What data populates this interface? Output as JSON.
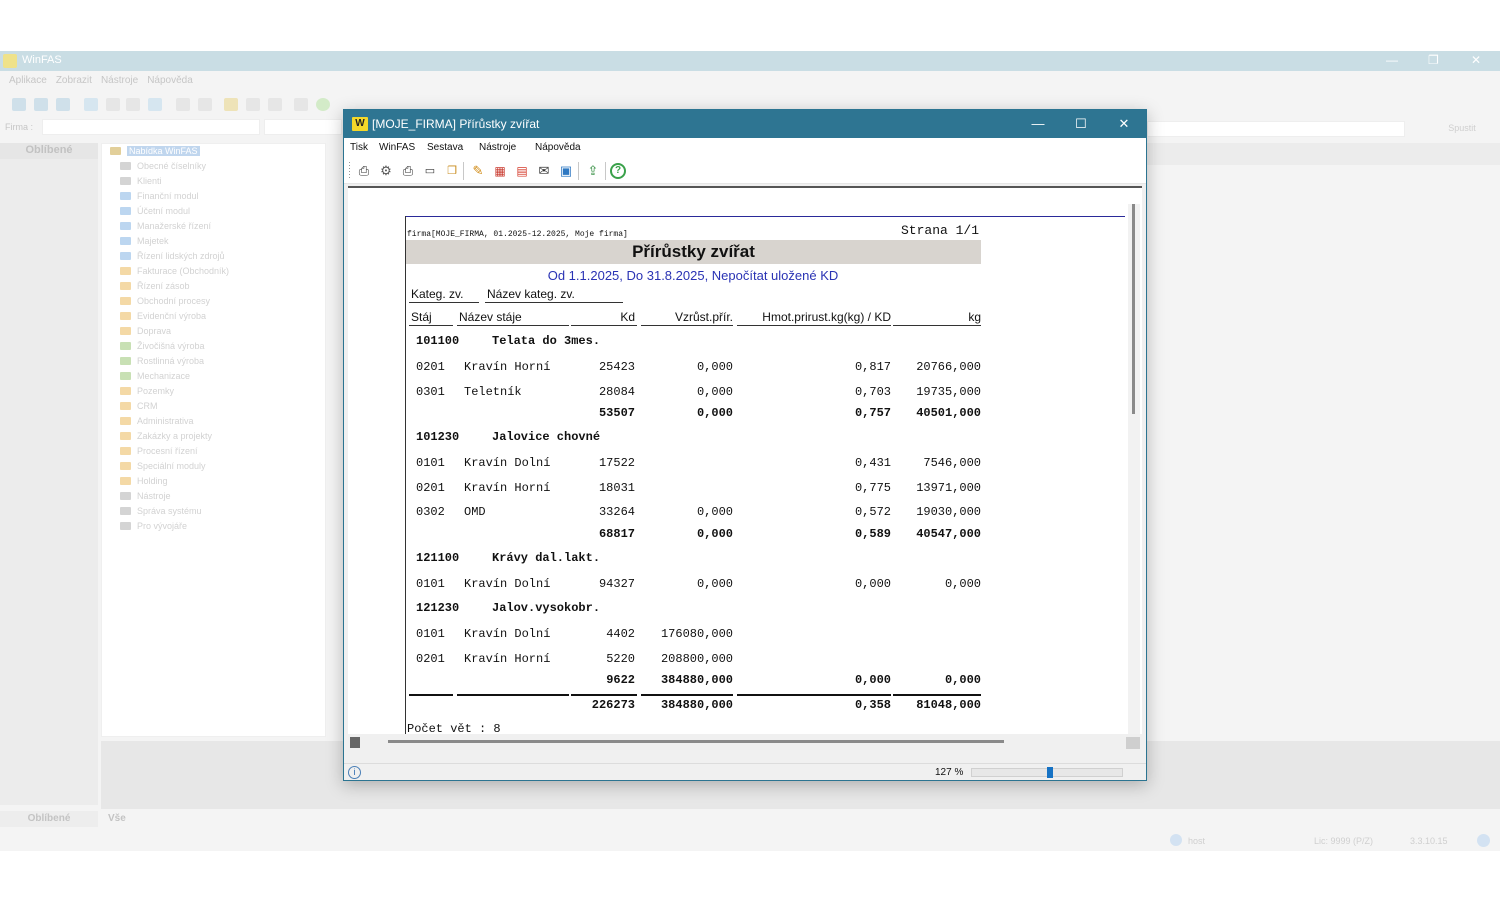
{
  "background_app": {
    "title": "WinFAS",
    "menu": [
      "Aplikace",
      "Zobrazit",
      "Nástroje",
      "Nápověda"
    ],
    "firma_label": "Firma :",
    "left_panel_header": "Oblíbené",
    "tree_root": "Nabídka WinFAS",
    "tree_items": [
      {
        "label": "Obecné číselníky",
        "color": "#d4d4d4"
      },
      {
        "label": "Klienti",
        "color": "#d4d4d4"
      },
      {
        "label": "Finanční modul",
        "color": "#bcd6f0"
      },
      {
        "label": "Účetní modul",
        "color": "#bcd6f0"
      },
      {
        "label": "Manažerské řízení",
        "color": "#bcd6f0"
      },
      {
        "label": "Majetek",
        "color": "#bcd6f0"
      },
      {
        "label": "Řízení lidských zdrojů",
        "color": "#bcd6f0"
      },
      {
        "label": "Fakturace (Obchodník)",
        "color": "#f4d9a6"
      },
      {
        "label": "Řízení zásob",
        "color": "#f4d9a6"
      },
      {
        "label": "Obchodní procesy",
        "color": "#f4d9a6"
      },
      {
        "label": "Evidenční výroba",
        "color": "#f4d9a6"
      },
      {
        "label": "Doprava",
        "color": "#f4d9a6"
      },
      {
        "label": "Živočišná výroba",
        "color": "#c8e0b4"
      },
      {
        "label": "Rostlinná výroba",
        "color": "#c8e0b4"
      },
      {
        "label": "Mechanizace",
        "color": "#c8e0b4"
      },
      {
        "label": "Pozemky",
        "color": "#f4d9a6"
      },
      {
        "label": "CRM",
        "color": "#f4d9a6"
      },
      {
        "label": "Administrativa",
        "color": "#f4d9a6"
      },
      {
        "label": "Zakázky a projekty",
        "color": "#f4d9a6"
      },
      {
        "label": "Procesní řízení",
        "color": "#f4d9a6"
      },
      {
        "label": "Speciální moduly",
        "color": "#f4d9a6"
      },
      {
        "label": "Holding",
        "color": "#f4d9a6"
      },
      {
        "label": "Nástroje",
        "color": "#d4d4d4"
      },
      {
        "label": "Správa systému",
        "color": "#d4d4d4"
      },
      {
        "label": "Pro vývojáře",
        "color": "#d4d4d4"
      }
    ],
    "bottom_tabs": [
      "Oblíbené",
      "Vše"
    ],
    "spust_label": "Spustit",
    "status_user": "host",
    "status_lic": "Lic: 9999 (P/Z)",
    "status_version": "3.3.10.15"
  },
  "dialog": {
    "title": "[MOJE_FIRMA] Přírůstky zvířat",
    "logo": "W",
    "menu": [
      "Tisk",
      "WinFAS",
      "Sestava",
      "Nástroje",
      "Nápověda"
    ],
    "zoom": "127 %",
    "zoom_fraction": 0.5
  },
  "report": {
    "firma_line": "firma[MOJE_FIRMA, 01.2025-12.2025, Moje firma]",
    "strana": "Strana 1/1",
    "title": "Přírůstky zvířat",
    "subtitle": "Od 1.1.2025, Do 31.8.2025, Nepočítat uložené KD",
    "group_headers": {
      "kateg": "Kateg. zv.",
      "nazev_kateg": "Název kateg. zv."
    },
    "columns": {
      "staj": "Stáj",
      "nazev_staje": "Název stáje",
      "kd": "Kd",
      "vzrust": "Vzrůst.přír.",
      "hmot": "Hmot.prirust.kg(kg) / KD",
      "kg": "kg"
    },
    "groups": [
      {
        "code": "101100",
        "name": "Telata do 3mes.",
        "rows": [
          {
            "staj": "0201",
            "nazev": "Kravín Horní",
            "kd": "25423",
            "vzrust": "0,000",
            "hmot": "0,817",
            "kg": "20766,000"
          },
          {
            "staj": "0301",
            "nazev": "Teletník",
            "kd": "28084",
            "vzrust": "0,000",
            "hmot": "0,703",
            "kg": "19735,000"
          }
        ],
        "total": {
          "kd": "53507",
          "vzrust": "0,000",
          "hmot": "0,757",
          "kg": "40501,000"
        }
      },
      {
        "code": "101230",
        "name": "Jalovice chovné",
        "rows": [
          {
            "staj": "0101",
            "nazev": "Kravín Dolní",
            "kd": "17522",
            "vzrust": "",
            "hmot": "0,431",
            "kg": "7546,000"
          },
          {
            "staj": "0201",
            "nazev": "Kravín Horní",
            "kd": "18031",
            "vzrust": "",
            "hmot": "0,775",
            "kg": "13971,000"
          },
          {
            "staj": "0302",
            "nazev": "OMD",
            "kd": "33264",
            "vzrust": "0,000",
            "hmot": "0,572",
            "kg": "19030,000"
          }
        ],
        "total": {
          "kd": "68817",
          "vzrust": "0,000",
          "hmot": "0,589",
          "kg": "40547,000"
        }
      },
      {
        "code": "121100",
        "name": "Krávy dal.lakt.",
        "rows": [
          {
            "staj": "0101",
            "nazev": "Kravín Dolní",
            "kd": "94327",
            "vzrust": "0,000",
            "hmot": "0,000",
            "kg": "0,000"
          }
        ]
      },
      {
        "code": "121230",
        "name": "Jalov.vysokobr.",
        "rows": [
          {
            "staj": "0101",
            "nazev": "Kravín Dolní",
            "kd": "4402",
            "vzrust": "176080,000",
            "hmot": "",
            "kg": ""
          },
          {
            "staj": "0201",
            "nazev": "Kravín Horní",
            "kd": "5220",
            "vzrust": "208800,000",
            "hmot": "",
            "kg": ""
          }
        ],
        "total": {
          "kd": "9622",
          "vzrust": "384880,000",
          "hmot": "0,000",
          "kg": "0,000"
        }
      }
    ],
    "grand_total": {
      "kd": "226273",
      "vzrust": "384880,000",
      "hmot": "0,358",
      "kg": "81048,000"
    },
    "pocet_vet": "Počet vět : 8"
  }
}
